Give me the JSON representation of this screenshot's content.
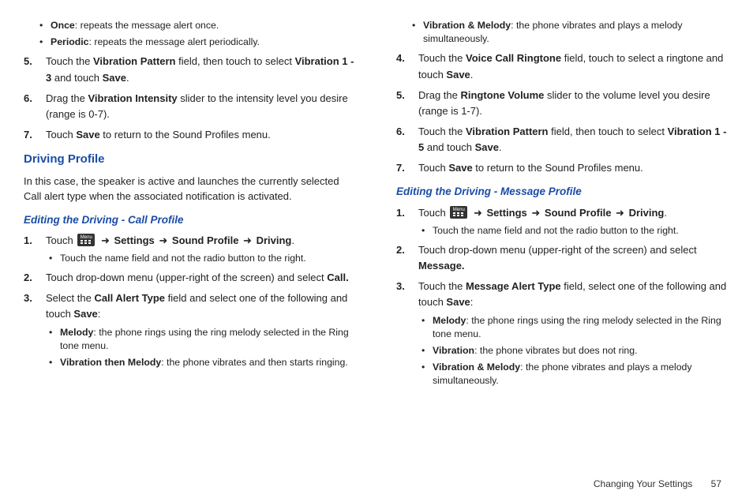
{
  "col1": {
    "bullets_top": [
      {
        "b": "Once",
        "t": ": repeats the message alert once."
      },
      {
        "b": "Periodic",
        "t": ": repeats the message alert periodically."
      }
    ],
    "steps_top": [
      {
        "n": "5.",
        "parts": [
          "Touch the ",
          {
            "b": "Vibration Pattern"
          },
          " field, then touch to select ",
          {
            "b": "Vibration 1 - 3"
          },
          " and touch ",
          {
            "b": "Save"
          },
          "."
        ]
      },
      {
        "n": "6.",
        "parts": [
          "Drag the ",
          {
            "b": "Vibration Intensity"
          },
          " slider to the intensity level you desire (range is 0-7)."
        ]
      },
      {
        "n": "7.",
        "parts": [
          "Touch ",
          {
            "b": "Save"
          },
          " to return to the Sound Profiles menu."
        ]
      }
    ],
    "heading": "Driving Profile",
    "intro": "In this case, the speaker is active and launches the currently selected Call alert type when the associated notification is activated.",
    "sub": "Editing the Driving - Call Profile",
    "steps": [
      {
        "n": "1.",
        "parts": [
          "Touch ",
          "[icon]",
          " ",
          {
            "arrow": true
          },
          " ",
          {
            "b": "Settings"
          },
          " ",
          {
            "arrow": true
          },
          " ",
          {
            "b": "Sound Profile"
          },
          " ",
          {
            "arrow": true
          },
          " ",
          {
            "b": "Driving"
          },
          "."
        ],
        "bullets": [
          {
            "t": "Touch the name field and not the radio button to the right."
          }
        ]
      },
      {
        "n": "2.",
        "parts": [
          "Touch drop-down menu (upper-right of the screen) and select ",
          {
            "b": "Call."
          }
        ]
      },
      {
        "n": "3.",
        "parts": [
          "Select the ",
          {
            "b": "Call Alert Type"
          },
          " field and select one of the following and touch ",
          {
            "b": "Save"
          },
          ":"
        ],
        "bullets": [
          {
            "b": "Melody",
            "t": ": the phone rings using the ring melody selected in the Ring tone menu."
          },
          {
            "b": "Vibration then Melody",
            "t": ": the phone vibrates and then starts ringing."
          }
        ]
      }
    ]
  },
  "col2": {
    "bullets_top": [
      {
        "b": "Vibration & Melody",
        "t": ": the phone vibrates and plays a melody simultaneously."
      }
    ],
    "steps_top": [
      {
        "n": "4.",
        "parts": [
          "Touch the ",
          {
            "b": "Voice Call Ringtone"
          },
          " field, touch to select a ringtone and touch ",
          {
            "b": "Save"
          },
          "."
        ]
      },
      {
        "n": "5.",
        "parts": [
          "Drag the ",
          {
            "b": "Ringtone Volume"
          },
          " slider to the volume level you desire (range is 1-7)."
        ]
      },
      {
        "n": "6.",
        "parts": [
          "Touch the ",
          {
            "b": "Vibration Pattern"
          },
          " field, then touch to select ",
          {
            "b": "Vibration 1 - 5"
          },
          " and touch ",
          {
            "b": "Save"
          },
          "."
        ]
      },
      {
        "n": "7.",
        "parts": [
          "Touch ",
          {
            "b": "Save"
          },
          " to return to the Sound Profiles menu."
        ]
      }
    ],
    "sub": "Editing the Driving - Message Profile",
    "steps": [
      {
        "n": "1.",
        "parts": [
          "Touch ",
          "[icon]",
          " ",
          {
            "arrow": true
          },
          " ",
          {
            "b": "Settings"
          },
          " ",
          {
            "arrow": true
          },
          " ",
          {
            "b": "Sound Profile"
          },
          " ",
          {
            "arrow": true
          },
          " ",
          {
            "b": "Driving"
          },
          "."
        ],
        "bullets": [
          {
            "t": "Touch the name field and not the radio button to the right."
          }
        ]
      },
      {
        "n": "2.",
        "parts": [
          "Touch drop-down menu (upper-right of the screen) and select ",
          {
            "b": "Message."
          }
        ]
      },
      {
        "n": "3.",
        "parts": [
          "Touch the ",
          {
            "b": "Message Alert Type"
          },
          " field, select one of the following and touch ",
          {
            "b": "Save"
          },
          ":"
        ],
        "bullets": [
          {
            "b": "Melody",
            "t": ": the phone rings using the ring melody selected in the Ring tone menu."
          },
          {
            "b": "Vibration",
            "t": ": the phone vibrates but does not ring."
          },
          {
            "b": "Vibration & Melody",
            "t": ": the phone vibrates and plays a melody simultaneously."
          }
        ]
      }
    ]
  },
  "footer": {
    "label": "Changing Your Settings",
    "page": "57"
  },
  "arrow_glyph": "➜"
}
